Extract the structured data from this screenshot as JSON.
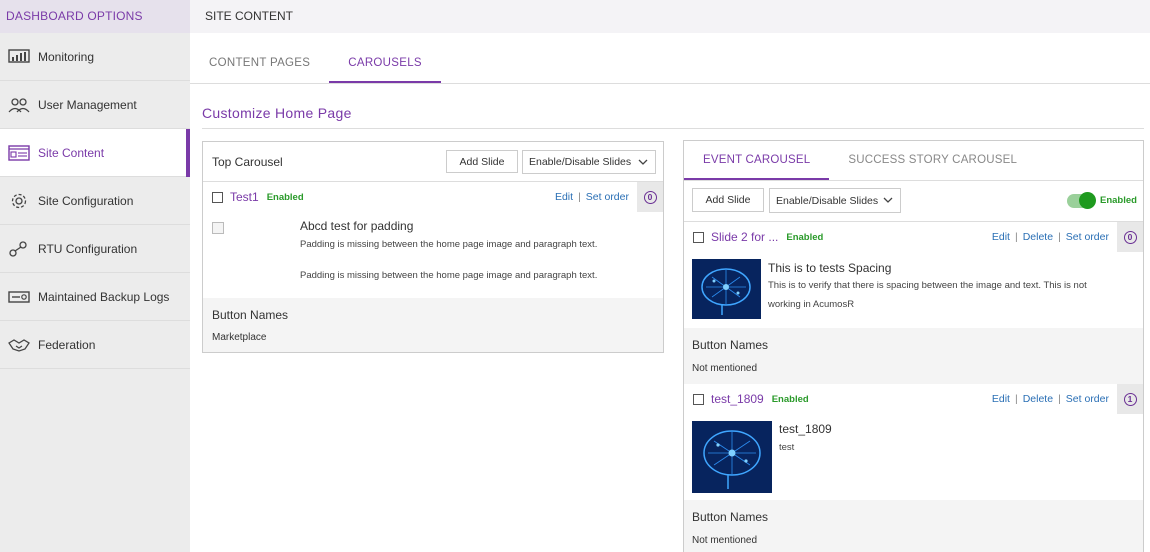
{
  "sidebar": {
    "header": "DASHBOARD OPTIONS",
    "items": [
      {
        "label": "Monitoring",
        "icon": "monitoring-icon"
      },
      {
        "label": "User Management",
        "icon": "users-icon"
      },
      {
        "label": "Site Content",
        "icon": "site-content-icon",
        "active": true
      },
      {
        "label": "Site Configuration",
        "icon": "gear-icon"
      },
      {
        "label": "RTU Configuration",
        "icon": "rtu-icon"
      },
      {
        "label": "Maintained Backup Logs",
        "icon": "backup-logs-icon"
      },
      {
        "label": "Federation",
        "icon": "handshake-icon"
      }
    ]
  },
  "topbar": {
    "title": "SITE CONTENT"
  },
  "tabs": [
    {
      "label": "CONTENT PAGES",
      "active": false
    },
    {
      "label": "CAROUSELS",
      "active": true
    }
  ],
  "page_title": "Customize Home Page",
  "top_carousel": {
    "title": "Top Carousel",
    "add_slide": "Add Slide",
    "enable_disable": "Enable/Disable Slides",
    "slide": {
      "name": "Test1",
      "status": "Enabled",
      "edit": "Edit",
      "set_order": "Set order",
      "order": "0",
      "heading": "Abcd test for padding",
      "desc1": "Padding is missing between the home page image and paragraph text.",
      "desc2": "Padding is missing between the home page image and paragraph text.",
      "button_names_label": "Button Names",
      "button_names_value": "Marketplace"
    }
  },
  "right_panel": {
    "tabs": [
      {
        "label": "EVENT CAROUSEL",
        "active": true
      },
      {
        "label": "SUCCESS STORY CAROUSEL",
        "active": false
      }
    ],
    "add_slide": "Add Slide",
    "enable_disable": "Enable/Disable Slides",
    "toggle_label": "Enabled",
    "slides": [
      {
        "name": "Slide 2 for ...",
        "status": "Enabled",
        "edit": "Edit",
        "delete": "Delete",
        "set_order": "Set order",
        "order": "0",
        "heading": "This is to tests Spacing",
        "desc": "This is to verify that there is spacing between the image and text. This is not working in AcumosR",
        "button_names_label": "Button Names",
        "button_names_value": "Not mentioned"
      },
      {
        "name": "test_1809",
        "status": "Enabled",
        "edit": "Edit",
        "delete": "Delete",
        "set_order": "Set order",
        "order": "1",
        "heading": "test_1809",
        "desc": "test",
        "button_names_label": "Button Names",
        "button_names_value": "Not mentioned"
      }
    ]
  },
  "colors": {
    "accent": "#7a3aa8",
    "enabled_green": "#2a9a2a",
    "link_blue": "#2a6fb5"
  }
}
